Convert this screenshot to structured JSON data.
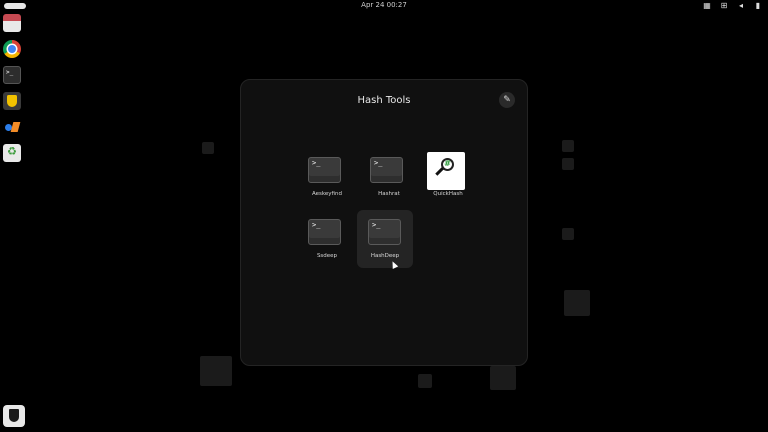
{
  "topbar": {
    "clock": "Apr 24  00:27",
    "tray": [
      {
        "icon": "network-icon",
        "glyph": "▦"
      },
      {
        "icon": "accessibility-icon",
        "glyph": "⊞"
      },
      {
        "icon": "volume-icon",
        "glyph": "◂"
      },
      {
        "icon": "battery-icon",
        "glyph": "▮"
      }
    ]
  },
  "dock": {
    "apps": [
      "files-icon",
      "chrome-icon",
      "terminal-icon",
      "shield-icon",
      "kali-icon",
      "trash-icon"
    ],
    "terminal_glyph": ">_",
    "bottom_app": "bitwarden-icon"
  },
  "folder": {
    "title": "Hash Tools",
    "edit_glyph": "✎",
    "apps": [
      {
        "label": "Aeskeyfind",
        "icon": "terminal-icon",
        "glyph": ">_"
      },
      {
        "label": "Hashrat",
        "icon": "terminal-icon",
        "glyph": ">_"
      },
      {
        "label": "QuickHash",
        "icon": "quickhash-icon"
      },
      {
        "label": "Ssdeep",
        "icon": "terminal-icon",
        "glyph": ">_"
      },
      {
        "label": "HashDeep",
        "icon": "terminal-icon",
        "glyph": ">_",
        "hovered": true
      }
    ]
  }
}
